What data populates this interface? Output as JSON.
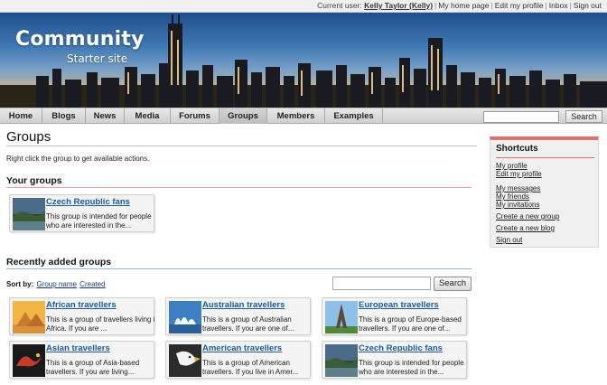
{
  "topbar": {
    "current_user_label": "Current user:",
    "user_name": "Kelly Taylor (Kelly)",
    "links": [
      "My home page",
      "Edit my profile",
      "Inbox",
      "Sign out"
    ]
  },
  "banner": {
    "logo_title": "Community",
    "logo_subtitle": "Starter site"
  },
  "nav": {
    "items": [
      "Home",
      "Blogs",
      "News",
      "Media",
      "Forums",
      "Groups",
      "Members",
      "Examples"
    ],
    "active": "Groups",
    "search_button": "Search"
  },
  "main": {
    "title": "Groups",
    "hint": "Right click the group to get available actions.",
    "your_groups_heading": "Your groups",
    "your_groups": [
      {
        "title": "Czech Republic fans",
        "desc1": "This group is intended for people",
        "desc2": "who are interested in the...",
        "icon": "czech-landscape"
      }
    ],
    "recent_heading": "Recently added groups",
    "sort_label": "Sort by:",
    "sort_links": [
      "Group name",
      "Created"
    ],
    "search_button": "Search",
    "recent_groups": [
      {
        "title": "African travellers",
        "desc1": "This is a group of travellers living in",
        "desc2": "Africa. If you are ...",
        "icon": "pyramids"
      },
      {
        "title": "Australian travellers",
        "desc1": "This is a group of Australian",
        "desc2": "travellers. If you are one of...",
        "icon": "sydney-opera"
      },
      {
        "title": "European travellers",
        "desc1": "This is a group of Europe-based",
        "desc2": "travellers. If you are one of...",
        "icon": "eiffel-tower"
      },
      {
        "title": "Asian travellers",
        "desc1": "This is a group of Asia-based",
        "desc2": "travellers. If you are living...",
        "icon": "dragon"
      },
      {
        "title": "American travellers",
        "desc1": "This is a group of American",
        "desc2": "travellers. If you live in Amer...",
        "icon": "eagle"
      },
      {
        "title": "Czech Republic fans",
        "desc1": "This group is intended for people",
        "desc2": "who are interested in the...",
        "icon": "czech-landscape"
      }
    ]
  },
  "sidebar": {
    "heading": "Shortcuts",
    "links": [
      "My profile",
      "Edit my profile",
      "My messages",
      "My friends",
      "My invitations",
      "Create a new group",
      "Create a new blog",
      "Sign out"
    ]
  },
  "colors": {
    "accent_red": "#e07070",
    "accent_blue": "#8fb8d8",
    "link": "#1d5aa0"
  }
}
